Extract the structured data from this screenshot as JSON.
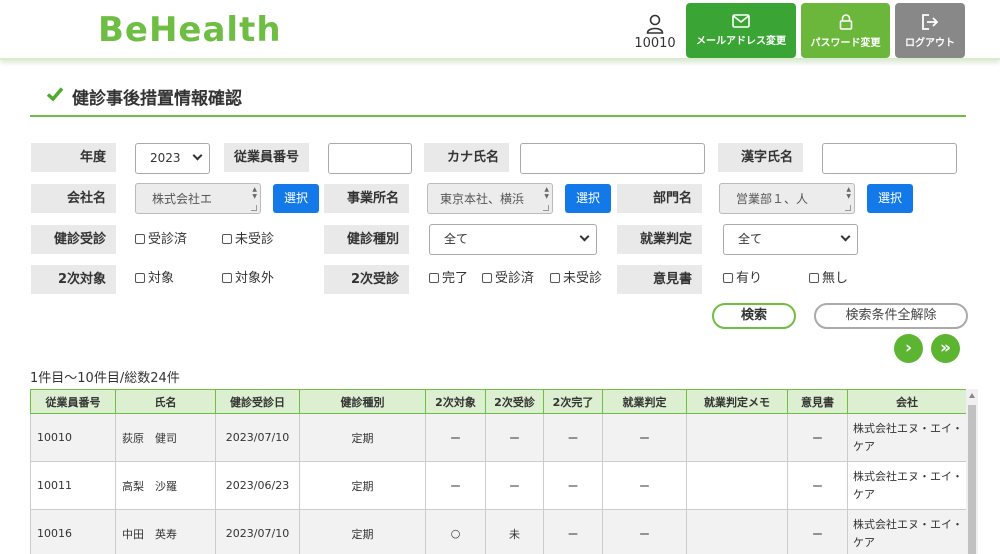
{
  "header": {
    "logo": "BeHealth",
    "user_id": "10010",
    "mail_btn": "メールアドレス変更",
    "pass_btn": "パスワード変更",
    "logout_btn": "ログアウト"
  },
  "page_title": "健診事後措置情報確認",
  "form": {
    "year_label": "年度",
    "year_value": "2023",
    "emp_no_label": "従業員番号",
    "kana_label": "カナ氏名",
    "kanji_label": "漢字氏名",
    "company_label": "会社名",
    "company_value": "株式会社エ",
    "select_btn": "選択",
    "office_label": "事業所名",
    "office_value": "東京本社、横浜",
    "dept_label": "部門名",
    "dept_value": "営業部１、人",
    "checkup_label": "健診受診",
    "checkup_opts": [
      "受診済",
      "未受診"
    ],
    "type_label": "健診種別",
    "type_value": "全て",
    "judge_label": "就業判定",
    "judge_value": "全て",
    "second_target_label": "2次対象",
    "second_target_opts": [
      "対象",
      "対象外"
    ],
    "second_exam_label": "2次受診",
    "second_exam_opts": [
      "完了",
      "受診済",
      "未受診"
    ],
    "opinion_label": "意見書",
    "opinion_opts": [
      "有り",
      "無し"
    ],
    "search_btn": "検索",
    "clear_btn": "検索条件全解除",
    "next_icon": "›",
    "last_icon": "»"
  },
  "result_count": "1件目〜10件目/総数24件",
  "table": {
    "headers": [
      "従業員番号",
      "氏名",
      "健診受診日",
      "健診種別",
      "2次対象",
      "2次受診",
      "2次完了",
      "就業判定",
      "就業判定メモ",
      "意見書",
      "会社"
    ],
    "rows": [
      {
        "emp": "10010",
        "name": "荻原　健司",
        "date": "2023/07/10",
        "type": "定期",
        "t2": "ー",
        "e2": "ー",
        "c2": "ー",
        "judge": "ー",
        "memo": "",
        "op": "ー",
        "co1": "株式会社エヌ・エイ・",
        "co2": "ケア"
      },
      {
        "emp": "10011",
        "name": "高梨　沙羅",
        "date": "2023/06/23",
        "type": "定期",
        "t2": "ー",
        "e2": "ー",
        "c2": "ー",
        "judge": "ー",
        "memo": "",
        "op": "ー",
        "co1": "株式会社エヌ・エイ・",
        "co2": "ケア"
      },
      {
        "emp": "10016",
        "name": "中田　英寿",
        "date": "2023/07/10",
        "type": "定期",
        "t2": "○",
        "e2": "未",
        "c2": "ー",
        "judge": "ー",
        "memo": "",
        "op": "ー",
        "co1": "株式会社エヌ・エイ・",
        "co2": "ケア"
      }
    ]
  },
  "colors": {
    "brand_green": "#6fbe44",
    "select_blue": "#1479e8",
    "logout_gray": "#888888"
  }
}
